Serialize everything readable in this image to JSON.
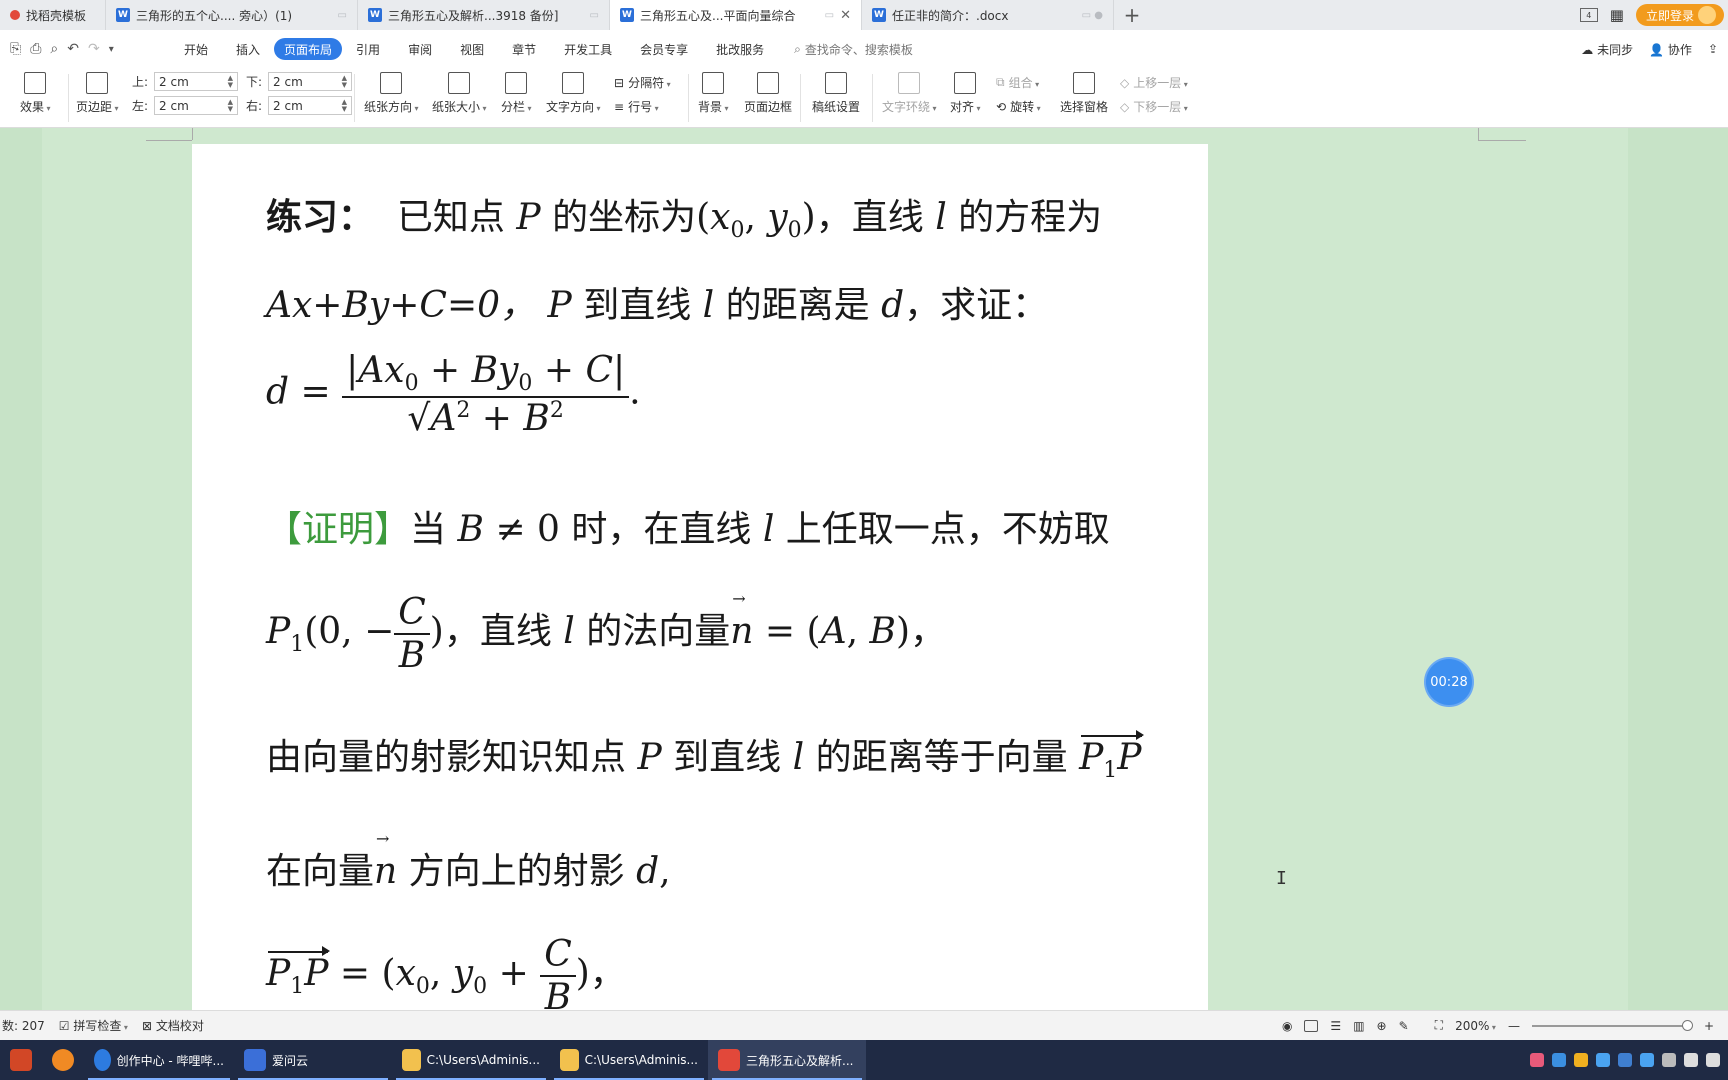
{
  "tabs": [
    {
      "label": "找稻壳模板",
      "active": false
    },
    {
      "label": "三角形的五个心.... 旁心）(1)",
      "active": false
    },
    {
      "label": "三角形五心及解析...3918 备份]",
      "active": false
    },
    {
      "label": "三角形五心及...平面向量综合",
      "active": true
    },
    {
      "label": "任正非的简介：.docx",
      "active": false
    }
  ],
  "tabbar": {
    "badge": "4",
    "login": "立即登录"
  },
  "menu": {
    "items": [
      "开始",
      "插入",
      "页面布局",
      "引用",
      "审阅",
      "视图",
      "章节",
      "开发工具",
      "会员专享",
      "批改服务"
    ],
    "active": "页面布局",
    "search_placeholder": "查找命令、搜索模板",
    "sync": "未同步",
    "collab": "协作"
  },
  "ribbon": {
    "effects": "效果",
    "margin": "页边距",
    "top_label": "上:",
    "top_value": "2 cm",
    "bottom_label": "下:",
    "bottom_value": "2 cm",
    "left_label": "左:",
    "left_value": "2 cm",
    "right_label": "右:",
    "right_value": "2 cm",
    "orientation": "纸张方向",
    "size": "纸张大小",
    "columns": "分栏",
    "text_direction": "文字方向",
    "breaks": "分隔符",
    "line_numbers": "行号",
    "background": "背景",
    "page_border": "页面边框",
    "manuscript": "稿纸设置",
    "text_wrap": "文字环绕",
    "align": "对齐",
    "group": "组合",
    "rotate": "旋转",
    "selection_pane": "选择窗格",
    "bring_forward": "上移一层",
    "send_backward": "下移一层"
  },
  "document": {
    "line1_label": "练习：",
    "line1_text": "已知点",
    "line1_text2": "的坐标为",
    "line1_text3": "，直线",
    "line1_text4": "的方程为",
    "line2_eq": "Ax+By+C=0，",
    "line2_text": "到直线",
    "line2_text2": "的距离是",
    "line2_text3": "，求证：",
    "proof_label": "【证明】",
    "proof_text": "当",
    "proof_text2": "时，在直线",
    "proof_text3": "上任取一点，不妨取",
    "normal_text": "，直线",
    "normal_text2": "的法向量",
    "projection_text": "由向量的射影知识知点",
    "projection_text2": "到直线",
    "projection_text3": "的距离等于向量",
    "direction_text": "在向量",
    "direction_text2": "方向上的射影",
    "timer": "00:28"
  },
  "statusbar": {
    "word_count": "数: 207",
    "spell_check": "拼写检查",
    "doc_proof": "文档校对",
    "zoom": "200%"
  },
  "taskbar": {
    "items": [
      "创作中心 - 哔哩哔...",
      "爱问云",
      "C:\\Users\\Adminis...",
      "C:\\Users\\Adminis...",
      "三角形五心及解析..."
    ]
  }
}
